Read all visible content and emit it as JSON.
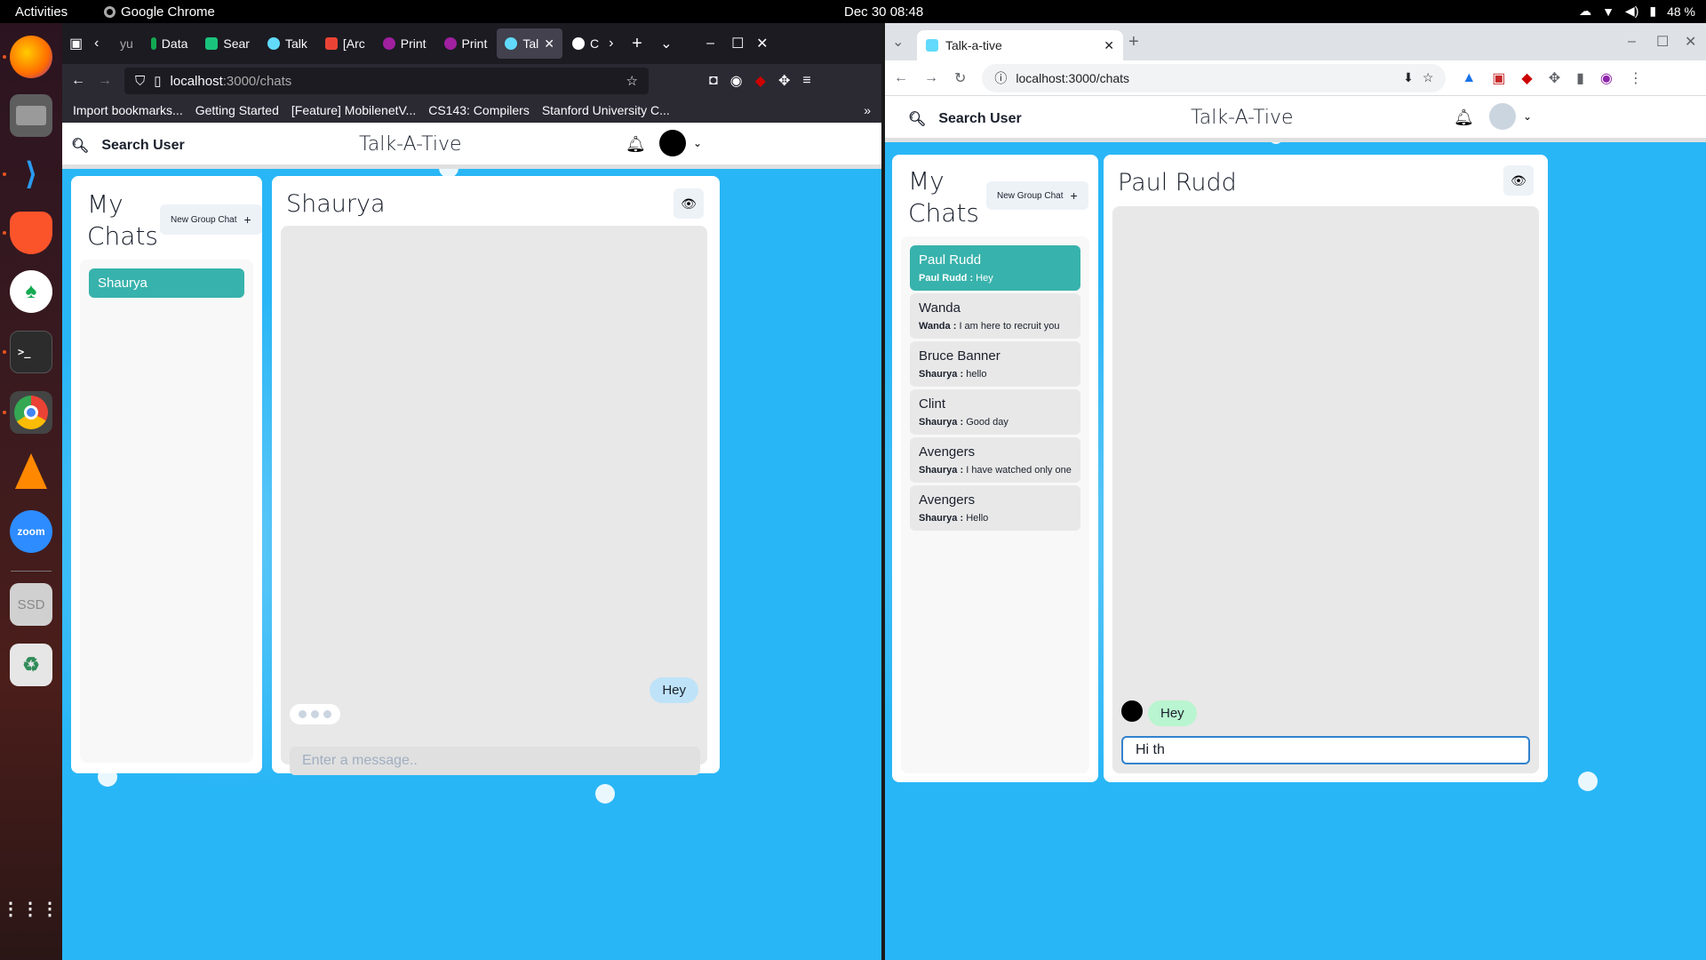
{
  "system": {
    "activities": "Activities",
    "app_name": "Google Chrome",
    "clock": "Dec 30  08:48",
    "battery": "48 %"
  },
  "dock": [
    "firefox",
    "files",
    "vscode",
    "brave",
    "mongodb-compass",
    "terminal",
    "chrome",
    "vlc",
    "zoom",
    "ssd",
    "trash",
    "show-apps"
  ],
  "left_browser": {
    "tabs": [
      "yu",
      "Data",
      "Sear",
      "Talk",
      "[Arc",
      "Print",
      "Print",
      "Tal",
      "C"
    ],
    "url_host": "localhost",
    "url_path": ":3000/chats",
    "bookmarks": [
      "Import bookmarks...",
      "Getting Started",
      "[Feature] MobilenetV...",
      "CS143: Compilers",
      "Stanford University C..."
    ]
  },
  "right_browser": {
    "tab_title": "Talk-a-tive",
    "url": "localhost:3000/chats"
  },
  "app": {
    "search_label": "Search User",
    "brand": "Talk-A-Tive",
    "my_chats": "My Chats",
    "new_group": "New Group Chat",
    "left": {
      "chats": [
        {
          "name": "Shaurya"
        }
      ],
      "active_chat": "Shaurya",
      "messages": [
        {
          "text": "Hey",
          "mine": true
        }
      ],
      "input_placeholder": "Enter a message.."
    },
    "right": {
      "chats": [
        {
          "name": "Paul Rudd",
          "sender": "Paul Rudd :",
          "preview": "Hey"
        },
        {
          "name": "Wanda",
          "sender": "Wanda :",
          "preview": "I am here to recruit you"
        },
        {
          "name": "Bruce Banner",
          "sender": "Shaurya :",
          "preview": "hello"
        },
        {
          "name": "Clint",
          "sender": "Shaurya :",
          "preview": "Good day"
        },
        {
          "name": "Avengers",
          "sender": "Shaurya :",
          "preview": "I have watched only one"
        },
        {
          "name": "Avengers",
          "sender": "Shaurya :",
          "preview": "Hello"
        }
      ],
      "active_chat": "Paul Rudd",
      "messages": [
        {
          "text": "Hey",
          "mine": false
        }
      ],
      "input_value": "Hi th"
    }
  }
}
